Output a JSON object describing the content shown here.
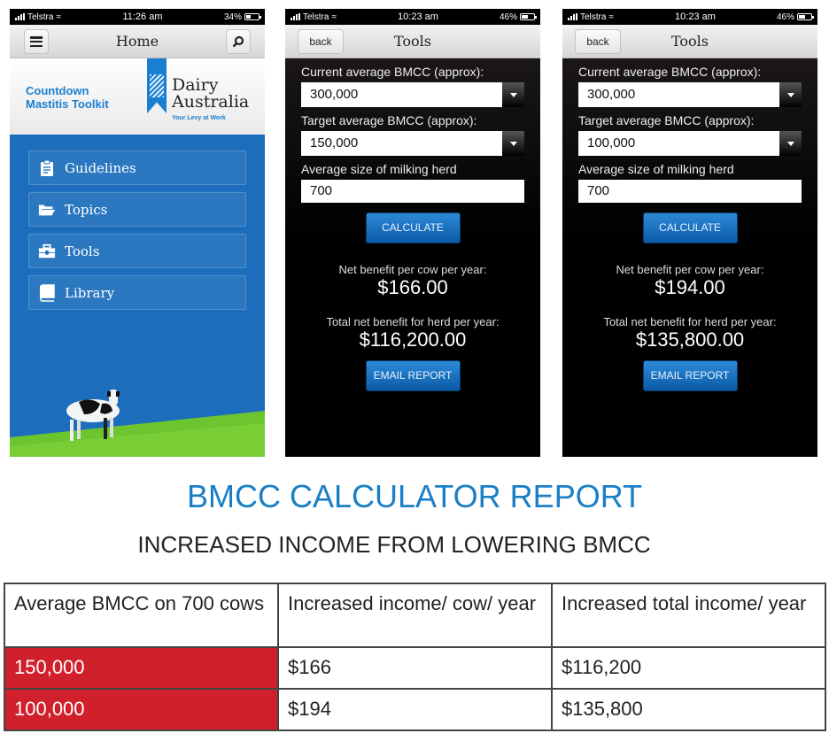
{
  "screens": {
    "home": {
      "status": {
        "carrier": "Telstra",
        "time": "11:26 am",
        "battery": "34%",
        "battery_level": 0.34
      },
      "nav": {
        "title": "Home",
        "menu_icon": "hamburger-icon",
        "search_icon": "search-icon"
      },
      "brand": {
        "app_name_line1": "Countdown",
        "app_name_line2": "Mastitis Toolkit",
        "org_line1": "Dairy",
        "org_line2": "Australia",
        "tagline": "Your Levy at Work"
      },
      "menu": [
        {
          "label": "Guidelines",
          "icon": "clipboard-icon"
        },
        {
          "label": "Topics",
          "icon": "folder-open-icon"
        },
        {
          "label": "Tools",
          "icon": "toolbox-icon"
        },
        {
          "label": "Library",
          "icon": "book-icon"
        }
      ]
    },
    "tools_1": {
      "status": {
        "carrier": "Telstra",
        "time": "10:23 am",
        "battery": "46%",
        "battery_level": 0.46
      },
      "nav": {
        "back_label": "back",
        "title": "Tools"
      },
      "current_label": "Current average BMCC (approx):",
      "current_value": "300,000",
      "target_label": "Target average BMCC (approx):",
      "target_value": "150,000",
      "herd_label": "Average size of milking herd",
      "herd_value": "700",
      "calculate_label": "CALCULATE",
      "per_cow_label": "Net benefit per cow per year:",
      "per_cow_value": "$166.00",
      "herd_total_label": "Total net benefit for herd per year:",
      "herd_total_value": "$116,200.00",
      "email_label": "EMAIL REPORT"
    },
    "tools_2": {
      "status": {
        "carrier": "Telstra",
        "time": "10:23 am",
        "battery": "46%",
        "battery_level": 0.46
      },
      "nav": {
        "back_label": "back",
        "title": "Tools"
      },
      "current_label": "Current average BMCC (approx):",
      "current_value": "300,000",
      "target_label": "Target average BMCC (approx):",
      "target_value": "100,000",
      "herd_label": "Average size of milking herd",
      "herd_value": "700",
      "calculate_label": "CALCULATE",
      "per_cow_label": "Net benefit per cow per year:",
      "per_cow_value": "$194.00",
      "herd_total_label": "Total net benefit for herd per year:",
      "herd_total_value": "$135,800.00",
      "email_label": "EMAIL REPORT"
    }
  },
  "report": {
    "title": "BMCC CALCULATOR REPORT",
    "subtitle": "INCREASED INCOME FROM LOWERING BMCC",
    "headers": [
      "Average BMCC on 700 cows",
      "Increased income/ cow/ year",
      "Increased total income/ year"
    ],
    "rows": [
      [
        "150,000",
        "$166",
        "$116,200"
      ],
      [
        "100,000",
        "$194",
        "$135,800"
      ]
    ],
    "colors": {
      "title": "#1a7fc6",
      "highlight": "#d0202c"
    }
  }
}
